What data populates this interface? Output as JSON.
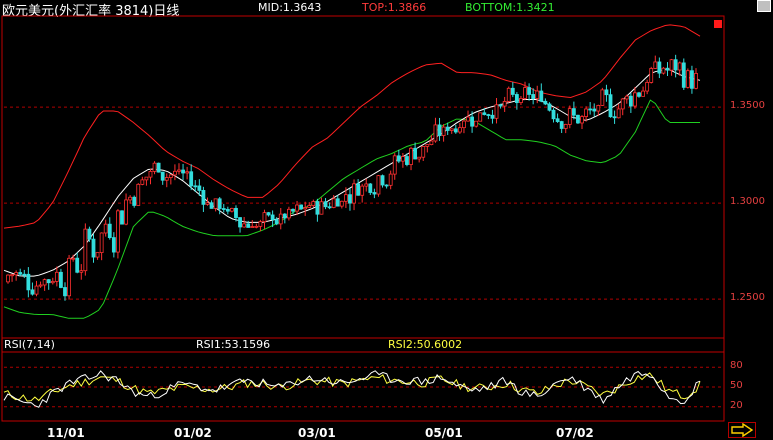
{
  "header": {
    "title": "欧元美元(外汇汇率 3814)日线",
    "mid": "MID:1.3643",
    "top": "TOP:1.3866",
    "bottom": "BOTTOM:1.3421"
  },
  "price_axis": {
    "ticks": [
      "1.3500",
      "1.3000",
      "1.2500"
    ],
    "values": [
      1.35,
      1.3,
      1.25
    ],
    "range": [
      1.2308,
      1.3975
    ]
  },
  "rsi_panel": {
    "label": "RSI(7,14)",
    "rsi1": "RSI1:53.1596",
    "rsi2": "RSI2:50.6002",
    "ticks": [
      "80",
      "50",
      "20"
    ],
    "tick_values": [
      80,
      50,
      20
    ]
  },
  "time_axis": {
    "labels": [
      "11/01",
      "01/02",
      "03/01",
      "05/01",
      "07/02"
    ]
  },
  "colors": {
    "upper_band": "#ff2020",
    "middle_line": "#ffffff",
    "lower_band": "#20d020",
    "candle_up": "#ff3030",
    "candle_down": "#33dddd",
    "rsi1": "#ffffff",
    "rsi2": "#ffff40",
    "grid": "#b00000",
    "frame": "#c00000"
  },
  "chart_data": {
    "type": "candlestick",
    "series_names": [
      "MID",
      "TOP",
      "BOTTOM"
    ],
    "mid_series": [
      1.265,
      1.262,
      1.262,
      1.265,
      1.27,
      1.278,
      1.29,
      1.303,
      1.313,
      1.318,
      1.317,
      1.312,
      1.305,
      1.298,
      1.292,
      1.29,
      1.29,
      1.292,
      1.294,
      1.297,
      1.301,
      1.306,
      1.311,
      1.316,
      1.321,
      1.326,
      1.331,
      1.336,
      1.342,
      1.347,
      1.35,
      1.352,
      1.354,
      1.354,
      1.35,
      1.345,
      1.343,
      1.347,
      1.352,
      1.36,
      1.368,
      1.37,
      1.366,
      1.364
    ],
    "upper_series": [
      1.287,
      1.288,
      1.29,
      1.3,
      1.317,
      1.335,
      1.348,
      1.348,
      1.342,
      1.335,
      1.327,
      1.322,
      1.318,
      1.312,
      1.307,
      1.303,
      1.303,
      1.31,
      1.32,
      1.329,
      1.334,
      1.342,
      1.35,
      1.356,
      1.363,
      1.368,
      1.372,
      1.373,
      1.368,
      1.368,
      1.367,
      1.364,
      1.362,
      1.358,
      1.356,
      1.355,
      1.358,
      1.364,
      1.375,
      1.385,
      1.39,
      1.393,
      1.392,
      1.387
    ],
    "lower_series": [
      1.246,
      1.243,
      1.242,
      1.242,
      1.24,
      1.24,
      1.245,
      1.265,
      1.288,
      1.296,
      1.293,
      1.288,
      1.285,
      1.283,
      1.283,
      1.283,
      1.286,
      1.29,
      1.296,
      1.299,
      1.306,
      1.313,
      1.318,
      1.323,
      1.326,
      1.33,
      1.332,
      1.34,
      1.344,
      1.343,
      1.338,
      1.333,
      1.333,
      1.332,
      1.33,
      1.325,
      1.322,
      1.321,
      1.325,
      1.337,
      1.355,
      1.342,
      1.342,
      1.342
    ],
    "rsi1_series": [
      35,
      28,
      22,
      40,
      55,
      62,
      70,
      60,
      42,
      35,
      45,
      55,
      50,
      45,
      52,
      60,
      55,
      48,
      58,
      63,
      60,
      55,
      63,
      68,
      62,
      60,
      58,
      65,
      52,
      45,
      50,
      60,
      42,
      35,
      55,
      65,
      48,
      30,
      52,
      70,
      72,
      38,
      30,
      58
    ],
    "rsi2_series": [
      40,
      35,
      30,
      42,
      52,
      58,
      65,
      60,
      48,
      40,
      45,
      50,
      48,
      46,
      50,
      56,
      55,
      50,
      55,
      60,
      58,
      55,
      60,
      64,
      60,
      58,
      56,
      62,
      54,
      48,
      50,
      56,
      46,
      40,
      52,
      60,
      50,
      38,
      50,
      64,
      68,
      45,
      36,
      52
    ],
    "ylim": [
      1.2308,
      1.3975
    ],
    "rsi_ylim": [
      0,
      100
    ],
    "legend": [
      "MID:1.3643",
      "TOP:1.3866",
      "BOTTOM:1.3421"
    ]
  }
}
